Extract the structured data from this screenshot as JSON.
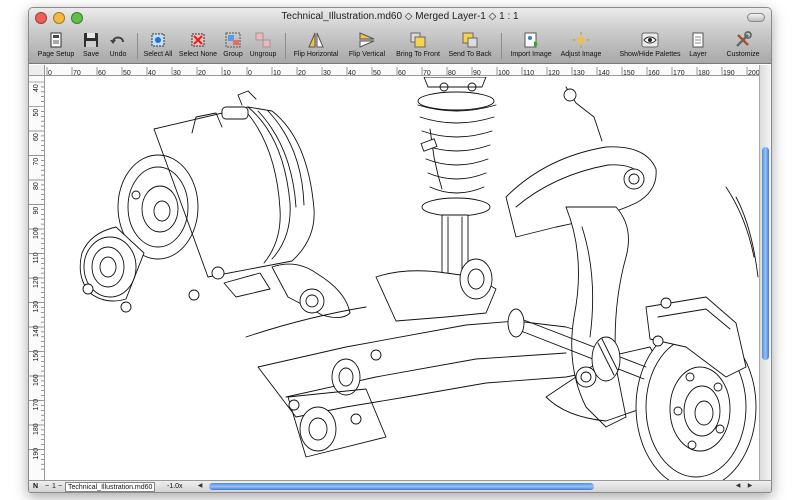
{
  "window": {
    "title": "Technical_Illustration.md60 ◇ Merged Layer-1 ◇ 1 : 1",
    "buttons": {
      "close_color": "#ee5f55",
      "minimize_color": "#f2bb3c",
      "zoom_color": "#5fbf47"
    }
  },
  "toolbar": {
    "items": [
      {
        "label": "Page Setup",
        "icon": "page-setup-icon"
      },
      {
        "label": "Save",
        "icon": "floppy-disk-icon"
      },
      {
        "label": "Undo",
        "icon": "undo-arrow-icon"
      },
      {
        "label": "Select All",
        "icon": "select-all-icon"
      },
      {
        "label": "Select None",
        "icon": "select-none-icon"
      },
      {
        "label": "Group",
        "icon": "group-icon"
      },
      {
        "label": "Ungroup",
        "icon": "ungroup-icon"
      },
      {
        "label": "Flip Horizontal",
        "icon": "flip-horizontal-icon"
      },
      {
        "label": "Flip Vertical",
        "icon": "flip-vertical-icon"
      },
      {
        "label": "Bring To Front",
        "icon": "bring-to-front-icon"
      },
      {
        "label": "Send To Back",
        "icon": "send-to-back-icon"
      },
      {
        "label": "Import Image",
        "icon": "import-image-icon"
      },
      {
        "label": "Adjust Image",
        "icon": "adjust-image-icon"
      },
      {
        "label": "Show/Hide Palettes",
        "icon": "eye-icon"
      },
      {
        "label": "Layer",
        "icon": "layer-icon"
      },
      {
        "label": "Customize",
        "icon": "customize-tools-icon"
      }
    ]
  },
  "rulers": {
    "horizontal": [
      "0",
      "70",
      "60",
      "50",
      "40",
      "30",
      "20",
      "10",
      "0",
      "10",
      "20",
      "30",
      "40",
      "50",
      "60",
      "70",
      "80",
      "90",
      "100",
      "110",
      "120",
      "130",
      "140",
      "150",
      "160",
      "170",
      "180",
      "190",
      "200"
    ],
    "vertical": [
      "40",
      "50",
      "60",
      "70",
      "80",
      "90",
      "100",
      "110",
      "120",
      "130",
      "140",
      "150",
      "160",
      "170",
      "180",
      "190"
    ]
  },
  "statusbar": {
    "mode": "N",
    "page": "1",
    "filename": "Technical_Illustration.md60",
    "zoom": "-1.0x"
  },
  "accent": "#3b7dd4"
}
